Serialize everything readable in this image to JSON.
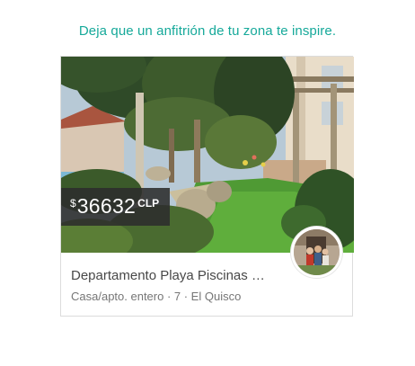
{
  "header": {
    "text": "Deja que un anfitrión de tu zona te inspire."
  },
  "listing": {
    "price": {
      "currency_symbol": "$",
      "amount": "36632",
      "currency_code": "CLP"
    },
    "title": "Departamento Playa Piscinas …",
    "subtitle": "Casa/apto. entero · 7 · El Quisco",
    "photo_icon": "listing-photo",
    "host_avatar_icon": "host-avatar"
  },
  "colors": {
    "accent": "#16a99a",
    "price_tag_bg": "#2c2c2c",
    "title_text": "#484848",
    "subtitle_text": "#767676"
  }
}
